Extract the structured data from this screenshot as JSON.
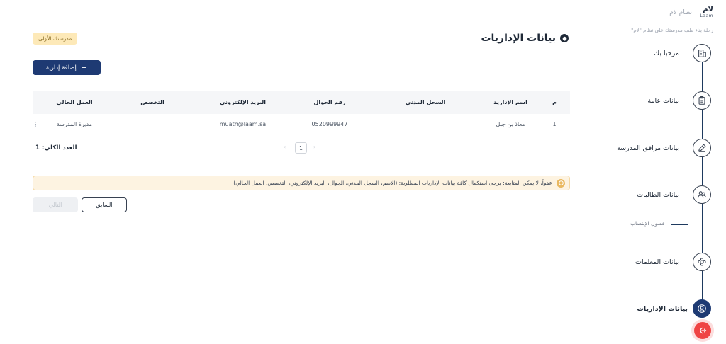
{
  "brand": {
    "logo_ar": "لام",
    "logo_en": "Laam",
    "name": "نظام لام",
    "tagline": "رحلة بناء ملف مدرستك على نظام \"لام\""
  },
  "steps": [
    {
      "label": "مرحبا بك",
      "icon": "building-icon"
    },
    {
      "label": "بيانات عامة",
      "icon": "clipboard-icon"
    },
    {
      "label": "بيانات مرافق المدرسة",
      "icon": "pencil-icon"
    },
    {
      "label": "بيانات الطالبات",
      "icon": "users-icon"
    },
    {
      "label": "بيانات المعلمات",
      "icon": "group-icon"
    },
    {
      "label": "بيانات الإداريات",
      "icon": "user-circle-icon"
    }
  ],
  "sub_step": {
    "label": "فصول الإنتساب"
  },
  "page": {
    "title": "بيانات الإداريات",
    "school_badge": "مدرستك الأولى",
    "add_button": "إضافة إدارية"
  },
  "table": {
    "headers": [
      "م",
      "اسم الإدارية",
      "السجل المدني",
      "رقم الجوال",
      "البريد الإلكتروني",
      "التخصص",
      "العمل الحالي"
    ],
    "rows": [
      {
        "index": "1",
        "name": "معاذ بن جبل",
        "civil_id": "",
        "phone": "0520999947",
        "email": "muath@laam.sa",
        "specialty": "",
        "job": "مديرة المدرسة"
      }
    ]
  },
  "pagination": {
    "current_page": "1",
    "total_label": "العدد الكلي: 1"
  },
  "alert": {
    "text": "عفواً، لا يمكن المتابعة: يرجى استكمال كافة بيانات الإداريات المطلوبة: (الاسم، السجل المدني، الجوال، البريد الإلكتروني، التخصص، العمل الحالي)"
  },
  "nav_buttons": {
    "previous": "السابق",
    "next": "التالي"
  },
  "colors": {
    "primary": "#1e3a73",
    "danger": "#ef4444",
    "warning_bg": "#fdf3e1",
    "badge_bg": "#fde9b8"
  }
}
